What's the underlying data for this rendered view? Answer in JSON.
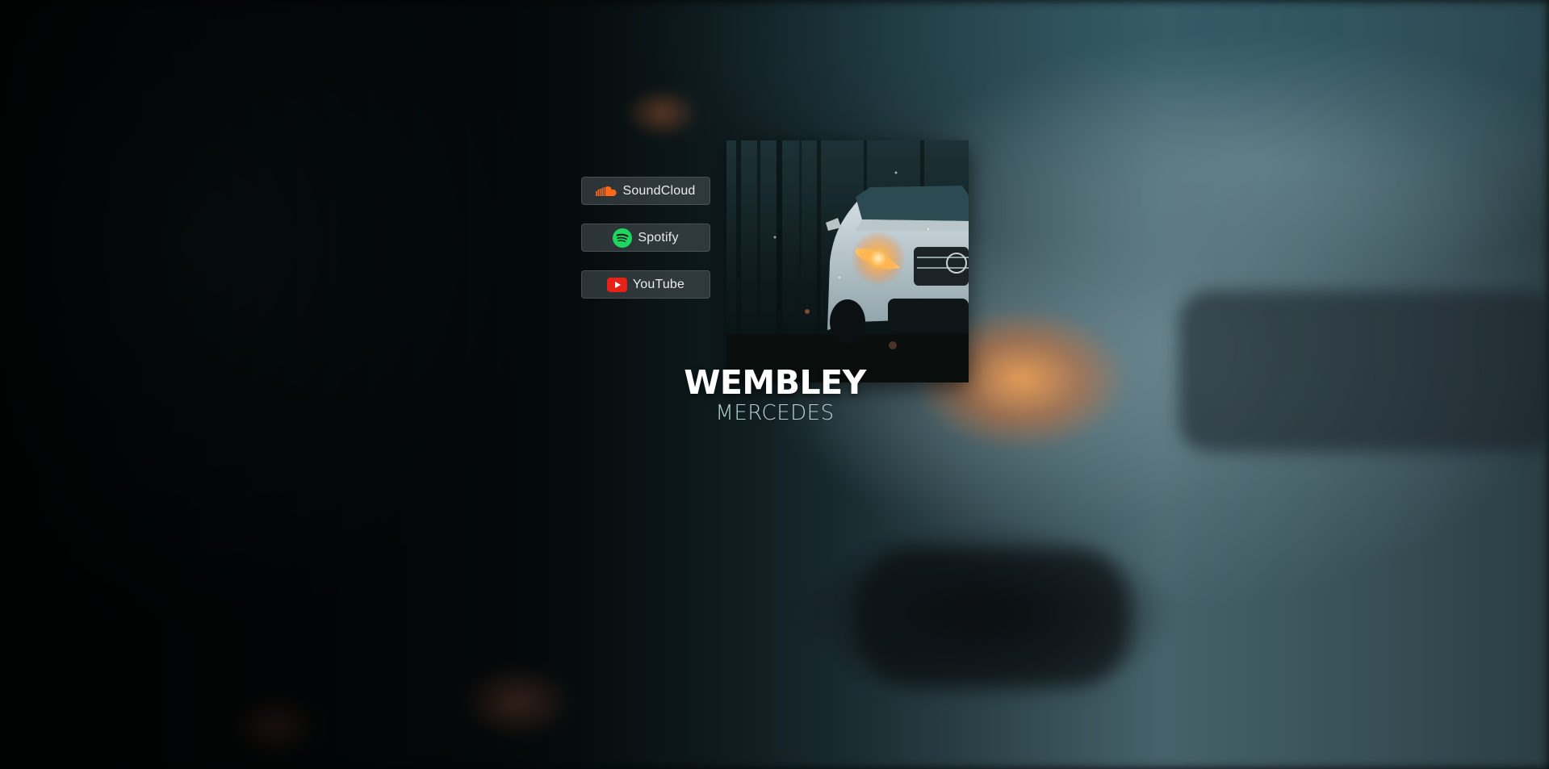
{
  "release": {
    "artist": "WEMBLEY",
    "title": "MERCEDES"
  },
  "links": [
    {
      "label": "SoundCloud",
      "icon": "soundcloud-icon",
      "color": "#ff6a1a"
    },
    {
      "label": "Spotify",
      "icon": "spotify-icon",
      "color": "#1ed760"
    },
    {
      "label": "YouTube",
      "icon": "youtube-icon",
      "color": "#e62117"
    }
  ]
}
